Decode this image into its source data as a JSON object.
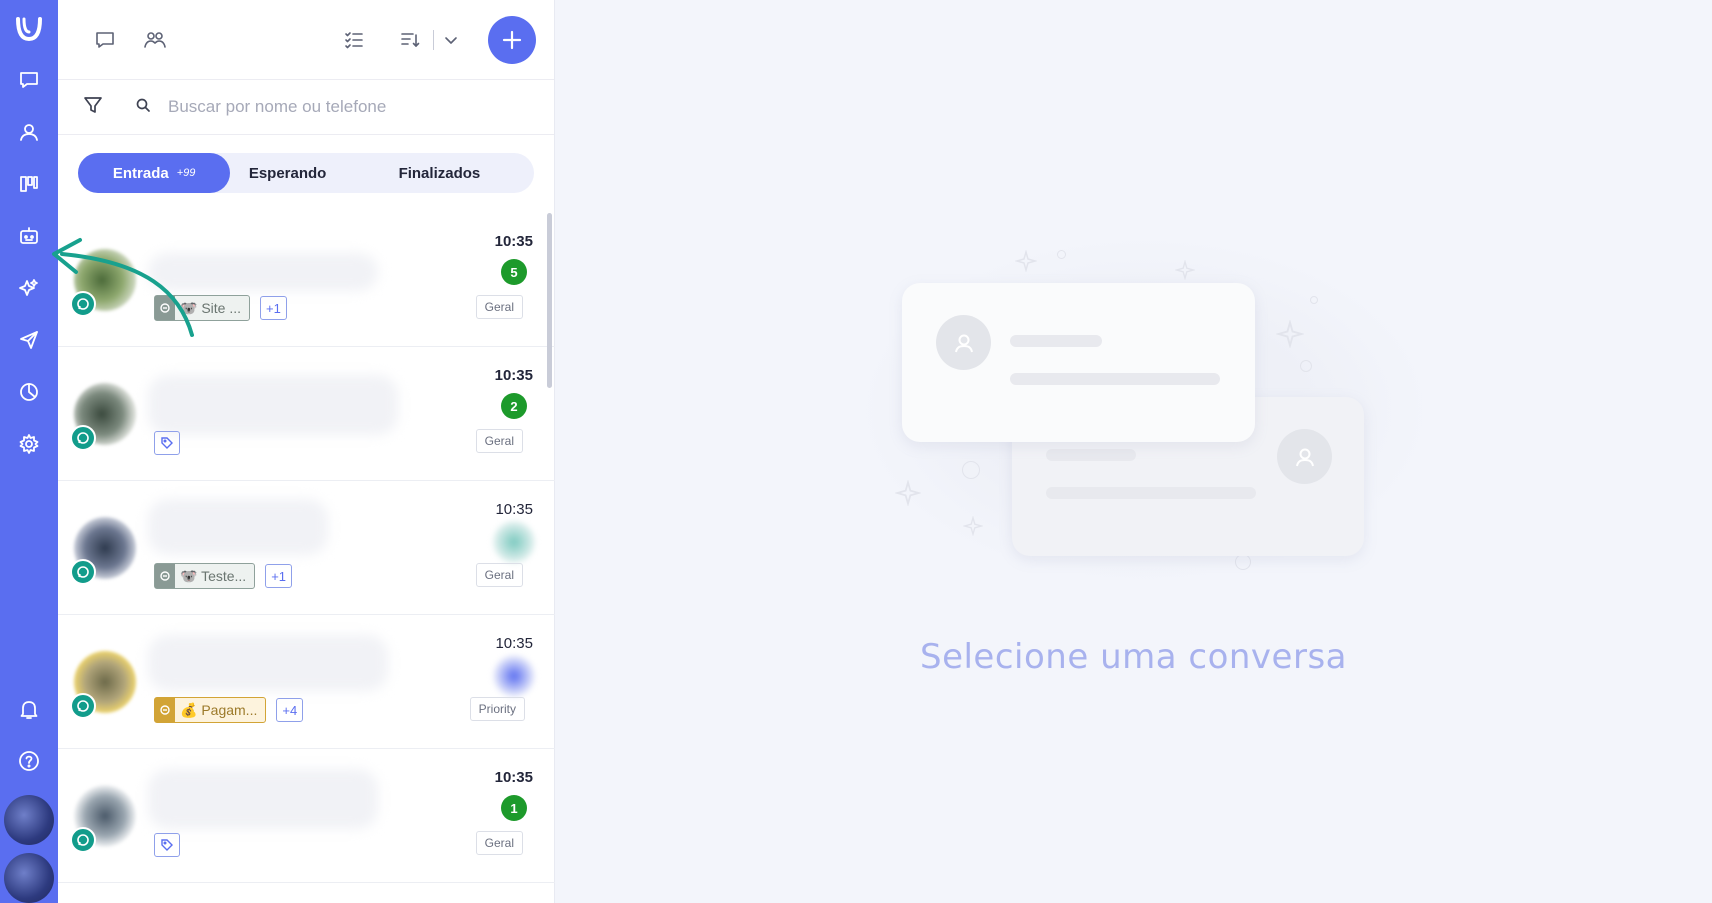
{
  "search": {
    "placeholder": "Buscar por nome ou telefone"
  },
  "tabs": [
    {
      "label": "Entrada",
      "count": "+99"
    },
    {
      "label": "Esperando"
    },
    {
      "label": "Finalizados"
    }
  ],
  "conversations": [
    {
      "time": "10:35",
      "badge": "5",
      "tag": "🐨 Site ...",
      "more": "+1",
      "queue": "Geral"
    },
    {
      "time": "10:35",
      "badge": "2",
      "queue": "Geral"
    },
    {
      "time": "10:35",
      "tag": "🐨 Teste...",
      "more": "+1",
      "queue": "Geral"
    },
    {
      "time": "10:35",
      "tag": "💰 Pagam...",
      "more": "+4",
      "queue": "Priority"
    },
    {
      "time": "10:35",
      "badge": "1",
      "queue": "Geral"
    }
  ],
  "empty_state": {
    "message": "Selecione uma conversa"
  },
  "colors": {
    "accent": "#5a6ef0",
    "badge_green": "#1d9a2b",
    "whatsapp": "#129c8b",
    "annotation_arrow": "#18a18e"
  },
  "icons": {
    "rail": [
      "logo-icon",
      "chat-icon",
      "contact-icon",
      "kanban-icon",
      "bot-icon",
      "sparkles-icon",
      "send-icon",
      "reports-icon",
      "settings-icon",
      "bell-icon",
      "help-icon"
    ],
    "toolbar": [
      "conversations-icon",
      "groups-icon",
      "checklist-icon",
      "sort-icon",
      "chevron-down-icon",
      "plus-icon"
    ]
  }
}
